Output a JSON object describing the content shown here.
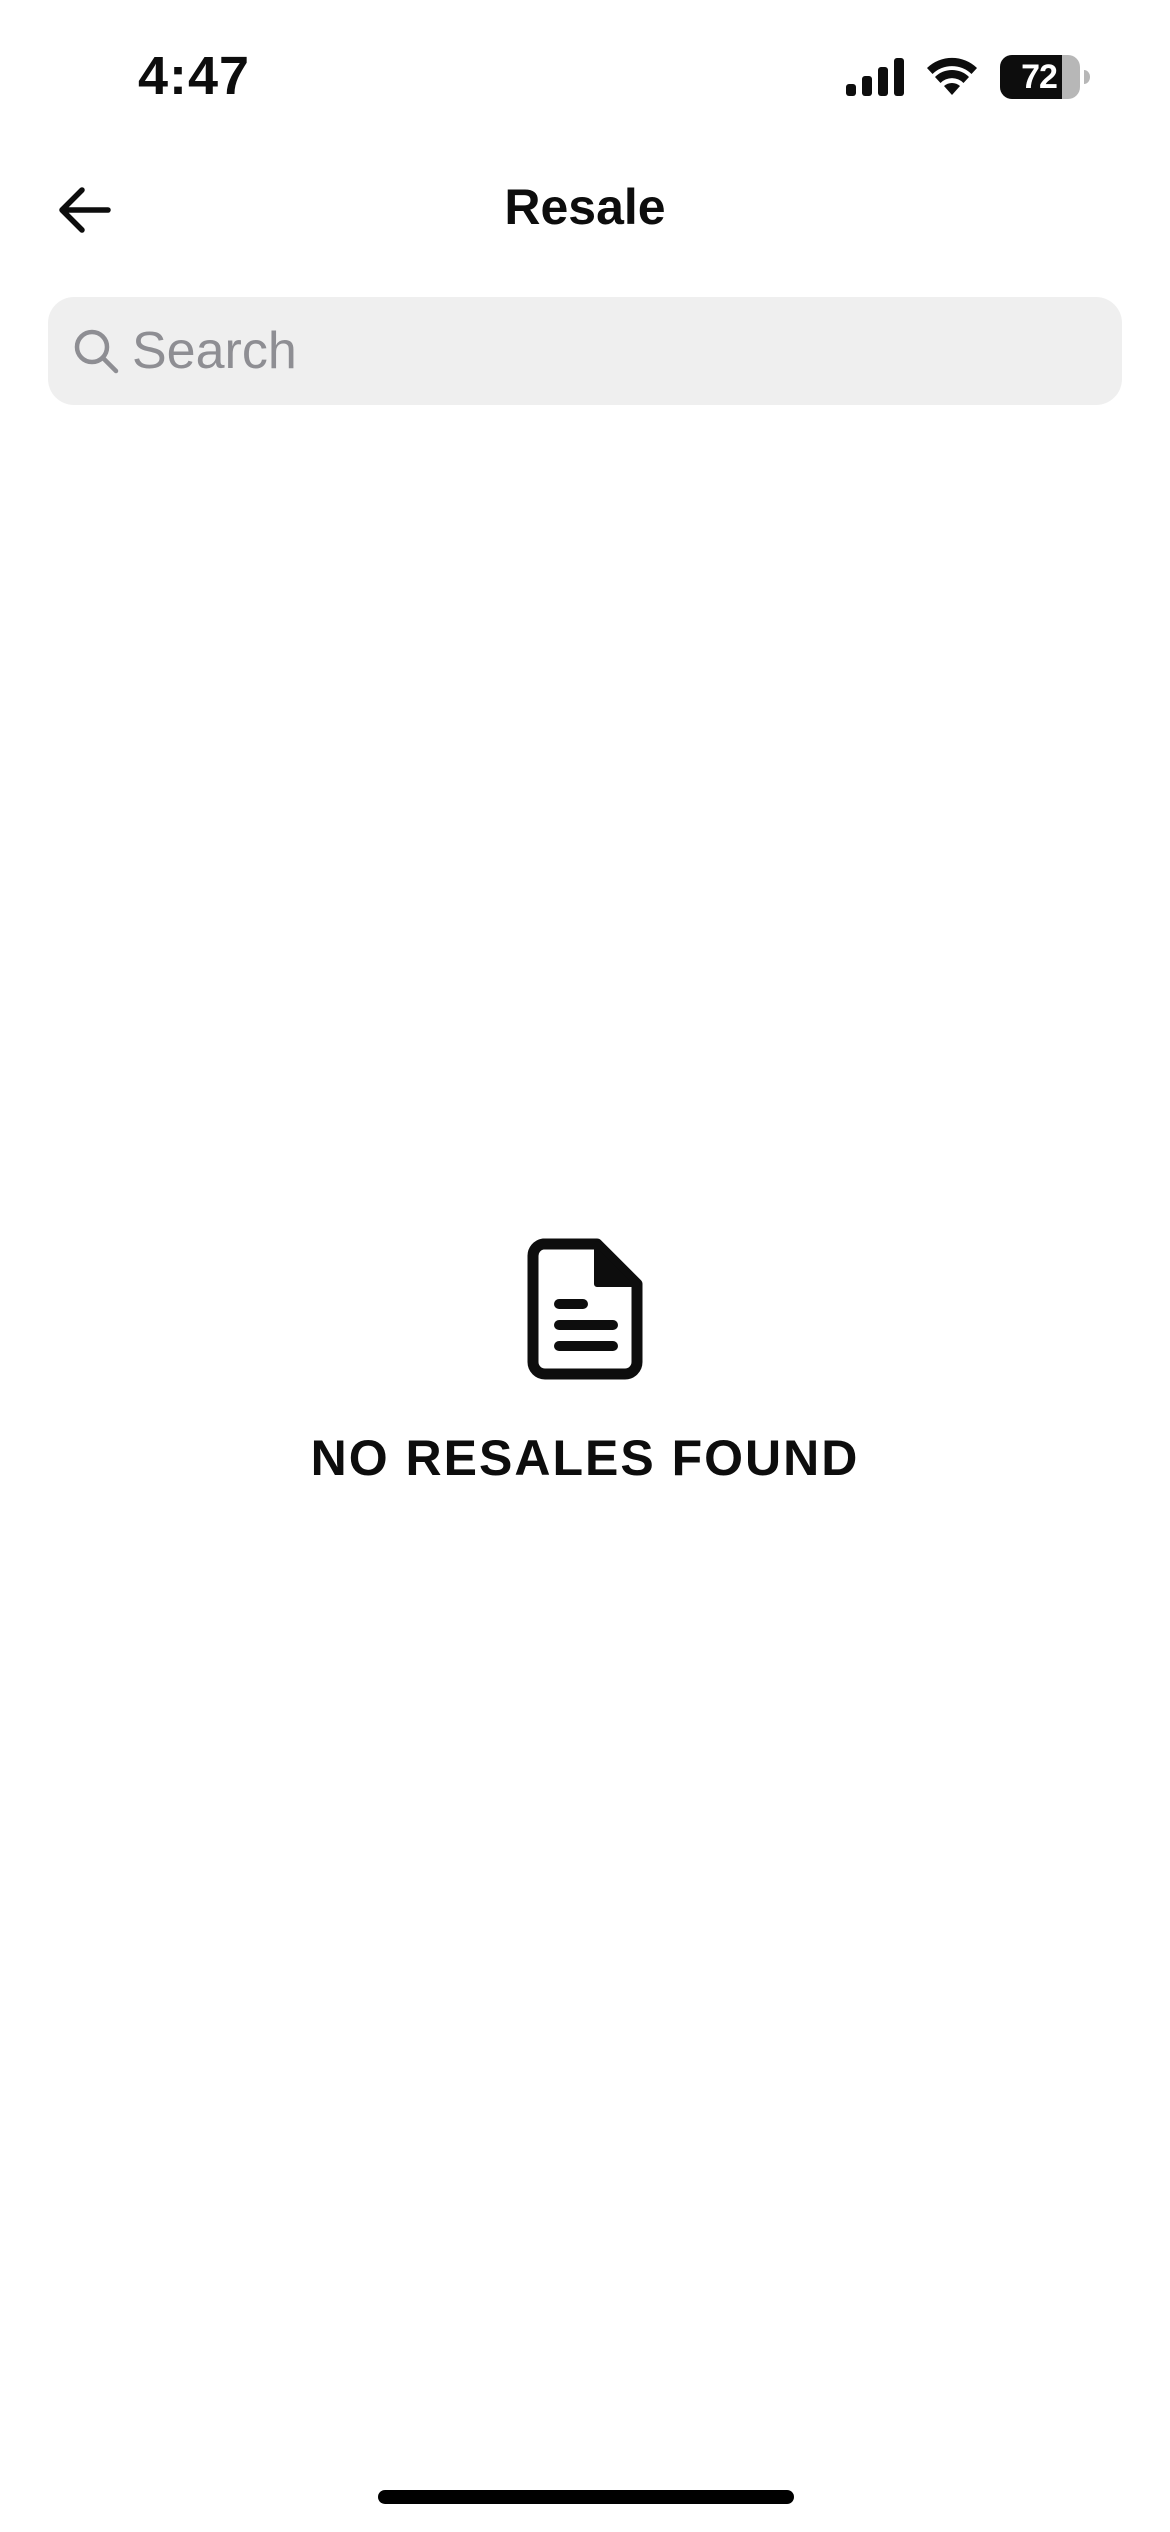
{
  "status_bar": {
    "time": "4:47",
    "battery_level": "72",
    "icons": [
      "signal-icon",
      "wifi-icon",
      "battery-icon"
    ]
  },
  "header": {
    "title": "Resale",
    "back_icon": "arrow-left-icon"
  },
  "search": {
    "placeholder": "Search",
    "value": "",
    "icon": "search-icon"
  },
  "empty_state": {
    "icon": "document-icon",
    "message": "NO RESALES FOUND"
  },
  "colors": {
    "background": "#ffffff",
    "text": "#0d0d0d",
    "search_background": "#efefef",
    "placeholder": "#8e8e93"
  }
}
